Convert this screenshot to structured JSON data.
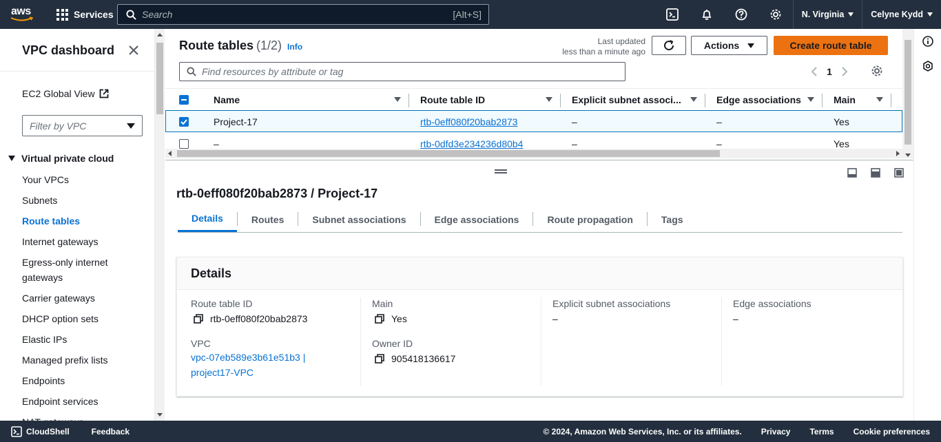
{
  "topnav": {
    "logo_text": "aws",
    "services_label": "Services",
    "search_placeholder": "Search",
    "search_shortcut": "[Alt+S]",
    "region": "N. Virginia",
    "user": "Celyne Kydd"
  },
  "sidebar": {
    "title": "VPC dashboard",
    "ec2_global_view": "EC2 Global View",
    "filter_placeholder": "Filter by VPC",
    "section": "Virtual private cloud",
    "items": [
      {
        "label": "Your VPCs"
      },
      {
        "label": "Subnets"
      },
      {
        "label": "Route tables",
        "active": true
      },
      {
        "label": "Internet gateways"
      },
      {
        "label": "Egress-only internet gateways"
      },
      {
        "label": "Carrier gateways"
      },
      {
        "label": "DHCP option sets"
      },
      {
        "label": "Elastic IPs"
      },
      {
        "label": "Managed prefix lists"
      },
      {
        "label": "Endpoints"
      },
      {
        "label": "Endpoint services"
      },
      {
        "label": "NAT gateways"
      }
    ]
  },
  "table": {
    "title": "Route tables",
    "count": "(1/2)",
    "info": "Info",
    "last_updated_label": "Last updated",
    "last_updated_value": "less than a minute ago",
    "actions_label": "Actions",
    "create_label": "Create route table",
    "search_placeholder": "Find resources by attribute or tag",
    "page": "1",
    "columns": [
      "Name",
      "Route table ID",
      "Explicit subnet associ...",
      "Edge associations",
      "Main"
    ],
    "rows": [
      {
        "selected": true,
        "name": "Project-17",
        "id": "rtb-0eff080f20bab2873",
        "explicit": "–",
        "edge": "–",
        "main": "Yes"
      },
      {
        "selected": false,
        "name": "–",
        "id": "rtb-0dfd3e234236d80b4",
        "explicit": "–",
        "edge": "–",
        "main": "Yes"
      }
    ]
  },
  "detail": {
    "title": "rtb-0eff080f20bab2873 / Project-17",
    "tabs": [
      "Details",
      "Routes",
      "Subnet associations",
      "Edge associations",
      "Route propagation",
      "Tags"
    ],
    "card_title": "Details",
    "route_table_id_label": "Route table ID",
    "route_table_id": "rtb-0eff080f20bab2873",
    "vpc_label": "VPC",
    "vpc_line1": "vpc-07eb589e3b61e51b3 |",
    "vpc_line2": "project17-VPC",
    "main_label": "Main",
    "main_value": "Yes",
    "owner_label": "Owner ID",
    "owner_value": "905418136617",
    "explicit_label": "Explicit subnet associations",
    "explicit_value": "–",
    "edge_label": "Edge associations",
    "edge_value": "–"
  },
  "footer": {
    "cloudshell": "CloudShell",
    "feedback": "Feedback",
    "copyright": "© 2024, Amazon Web Services, Inc. or its affiliates.",
    "privacy": "Privacy",
    "terms": "Terms",
    "cookies": "Cookie preferences"
  },
  "colors": {
    "nav_bg": "#232f3e",
    "accent_orange": "#ec7211",
    "link_blue": "#0972d3",
    "selected_row_bg": "#f1faff"
  }
}
